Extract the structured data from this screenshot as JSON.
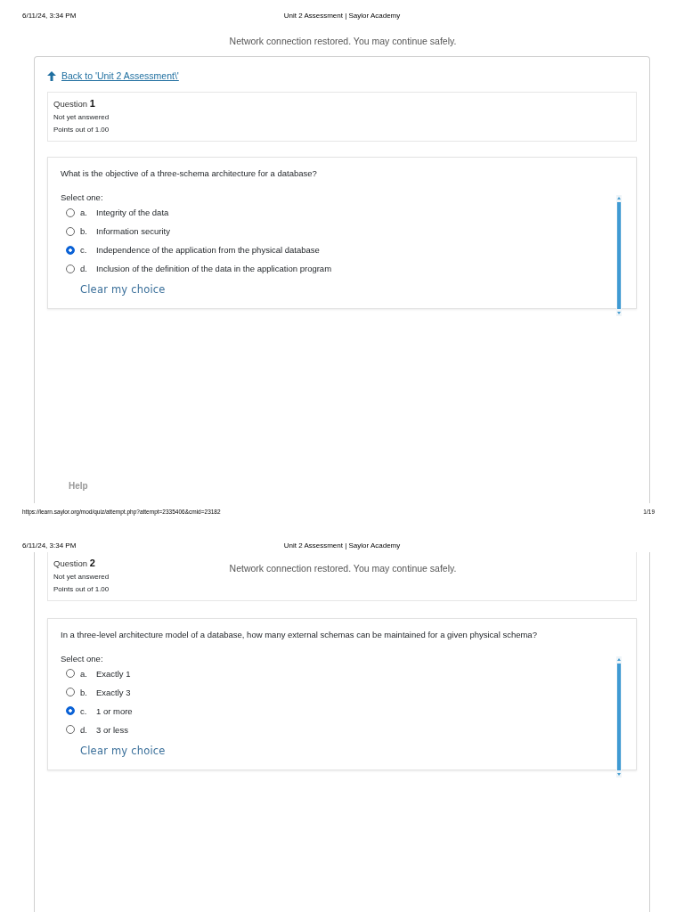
{
  "pages": [
    {
      "header": {
        "date": "6/11/24, 3:34 PM",
        "title": "Unit 2 Assessment | Saylor Academy"
      },
      "toast": "Network connection restored. You may continue safely.",
      "back_link": "Back to 'Unit 2 Assessment\\'",
      "question": {
        "label": "Question",
        "number": "1",
        "status": "Not yet answered",
        "points": "Points out of 1.00",
        "text": "What is the objective of a three-schema architecture for a database?",
        "prompt": "Select one:",
        "options": [
          {
            "letter": "a.",
            "text": "Integrity of the data",
            "selected": false
          },
          {
            "letter": "b.",
            "text": "Information security",
            "selected": false
          },
          {
            "letter": "c.",
            "text": "Independence of the application from the physical database",
            "selected": true
          },
          {
            "letter": "d.",
            "text": "Inclusion of the definition of the data in the application program",
            "selected": false
          }
        ],
        "clear": "Clear my choice"
      },
      "help": "Help",
      "footer": {
        "url": "https://learn.saylor.org/mod/quiz/attempt.php?attempt=2335406&cmid=23182",
        "page": "1/19"
      }
    },
    {
      "header": {
        "date": "6/11/24, 3:34 PM",
        "title": "Unit 2 Assessment | Saylor Academy"
      },
      "toast": "Network connection restored. You may continue safely.",
      "question": {
        "label": "Question",
        "number": "2",
        "status": "Not yet answered",
        "points": "Points out of 1.00",
        "text": "In a three-level architecture model of a database, how many external schemas can be maintained for a given physical schema?",
        "prompt": "Select one:",
        "options": [
          {
            "letter": "a.",
            "text": "Exactly 1",
            "selected": false
          },
          {
            "letter": "b.",
            "text": "Exactly 3",
            "selected": false
          },
          {
            "letter": "c.",
            "text": "1 or more",
            "selected": true
          },
          {
            "letter": "d.",
            "text": "3 or less",
            "selected": false
          }
        ],
        "clear": "Clear my choice"
      }
    }
  ]
}
